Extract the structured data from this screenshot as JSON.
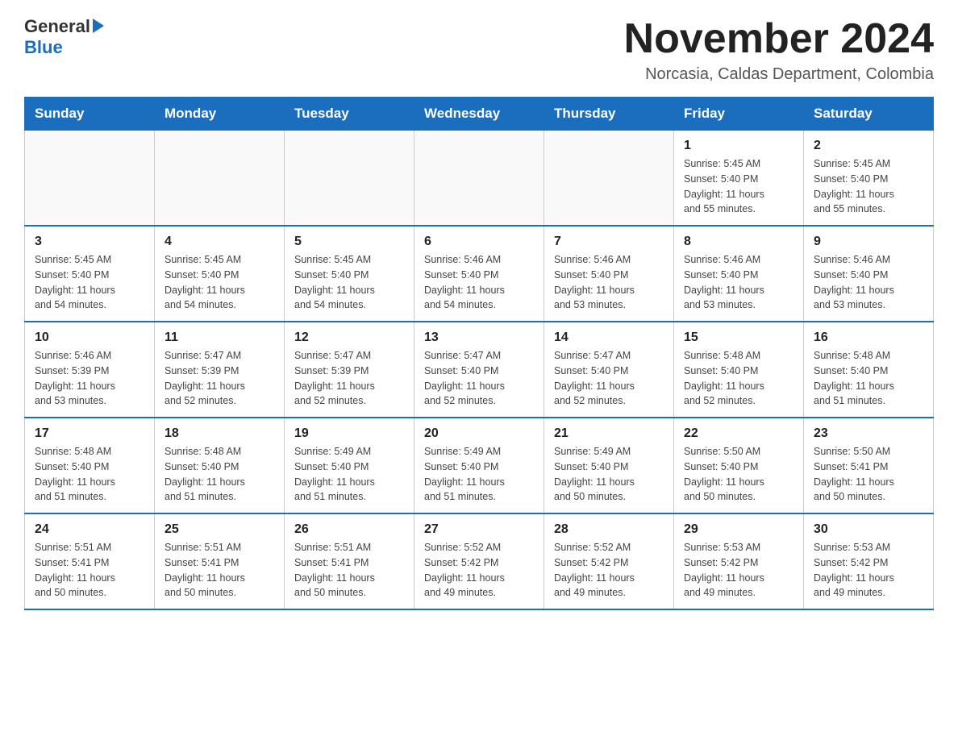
{
  "header": {
    "logo_general": "General",
    "logo_blue": "Blue",
    "month_title": "November 2024",
    "location": "Norcasia, Caldas Department, Colombia"
  },
  "days_of_week": [
    "Sunday",
    "Monday",
    "Tuesday",
    "Wednesday",
    "Thursday",
    "Friday",
    "Saturday"
  ],
  "weeks": [
    {
      "days": [
        {
          "number": "",
          "info": ""
        },
        {
          "number": "",
          "info": ""
        },
        {
          "number": "",
          "info": ""
        },
        {
          "number": "",
          "info": ""
        },
        {
          "number": "",
          "info": ""
        },
        {
          "number": "1",
          "info": "Sunrise: 5:45 AM\nSunset: 5:40 PM\nDaylight: 11 hours\nand 55 minutes."
        },
        {
          "number": "2",
          "info": "Sunrise: 5:45 AM\nSunset: 5:40 PM\nDaylight: 11 hours\nand 55 minutes."
        }
      ]
    },
    {
      "days": [
        {
          "number": "3",
          "info": "Sunrise: 5:45 AM\nSunset: 5:40 PM\nDaylight: 11 hours\nand 54 minutes."
        },
        {
          "number": "4",
          "info": "Sunrise: 5:45 AM\nSunset: 5:40 PM\nDaylight: 11 hours\nand 54 minutes."
        },
        {
          "number": "5",
          "info": "Sunrise: 5:45 AM\nSunset: 5:40 PM\nDaylight: 11 hours\nand 54 minutes."
        },
        {
          "number": "6",
          "info": "Sunrise: 5:46 AM\nSunset: 5:40 PM\nDaylight: 11 hours\nand 54 minutes."
        },
        {
          "number": "7",
          "info": "Sunrise: 5:46 AM\nSunset: 5:40 PM\nDaylight: 11 hours\nand 53 minutes."
        },
        {
          "number": "8",
          "info": "Sunrise: 5:46 AM\nSunset: 5:40 PM\nDaylight: 11 hours\nand 53 minutes."
        },
        {
          "number": "9",
          "info": "Sunrise: 5:46 AM\nSunset: 5:40 PM\nDaylight: 11 hours\nand 53 minutes."
        }
      ]
    },
    {
      "days": [
        {
          "number": "10",
          "info": "Sunrise: 5:46 AM\nSunset: 5:39 PM\nDaylight: 11 hours\nand 53 minutes."
        },
        {
          "number": "11",
          "info": "Sunrise: 5:47 AM\nSunset: 5:39 PM\nDaylight: 11 hours\nand 52 minutes."
        },
        {
          "number": "12",
          "info": "Sunrise: 5:47 AM\nSunset: 5:39 PM\nDaylight: 11 hours\nand 52 minutes."
        },
        {
          "number": "13",
          "info": "Sunrise: 5:47 AM\nSunset: 5:40 PM\nDaylight: 11 hours\nand 52 minutes."
        },
        {
          "number": "14",
          "info": "Sunrise: 5:47 AM\nSunset: 5:40 PM\nDaylight: 11 hours\nand 52 minutes."
        },
        {
          "number": "15",
          "info": "Sunrise: 5:48 AM\nSunset: 5:40 PM\nDaylight: 11 hours\nand 52 minutes."
        },
        {
          "number": "16",
          "info": "Sunrise: 5:48 AM\nSunset: 5:40 PM\nDaylight: 11 hours\nand 51 minutes."
        }
      ]
    },
    {
      "days": [
        {
          "number": "17",
          "info": "Sunrise: 5:48 AM\nSunset: 5:40 PM\nDaylight: 11 hours\nand 51 minutes."
        },
        {
          "number": "18",
          "info": "Sunrise: 5:48 AM\nSunset: 5:40 PM\nDaylight: 11 hours\nand 51 minutes."
        },
        {
          "number": "19",
          "info": "Sunrise: 5:49 AM\nSunset: 5:40 PM\nDaylight: 11 hours\nand 51 minutes."
        },
        {
          "number": "20",
          "info": "Sunrise: 5:49 AM\nSunset: 5:40 PM\nDaylight: 11 hours\nand 51 minutes."
        },
        {
          "number": "21",
          "info": "Sunrise: 5:49 AM\nSunset: 5:40 PM\nDaylight: 11 hours\nand 50 minutes."
        },
        {
          "number": "22",
          "info": "Sunrise: 5:50 AM\nSunset: 5:40 PM\nDaylight: 11 hours\nand 50 minutes."
        },
        {
          "number": "23",
          "info": "Sunrise: 5:50 AM\nSunset: 5:41 PM\nDaylight: 11 hours\nand 50 minutes."
        }
      ]
    },
    {
      "days": [
        {
          "number": "24",
          "info": "Sunrise: 5:51 AM\nSunset: 5:41 PM\nDaylight: 11 hours\nand 50 minutes."
        },
        {
          "number": "25",
          "info": "Sunrise: 5:51 AM\nSunset: 5:41 PM\nDaylight: 11 hours\nand 50 minutes."
        },
        {
          "number": "26",
          "info": "Sunrise: 5:51 AM\nSunset: 5:41 PM\nDaylight: 11 hours\nand 50 minutes."
        },
        {
          "number": "27",
          "info": "Sunrise: 5:52 AM\nSunset: 5:42 PM\nDaylight: 11 hours\nand 49 minutes."
        },
        {
          "number": "28",
          "info": "Sunrise: 5:52 AM\nSunset: 5:42 PM\nDaylight: 11 hours\nand 49 minutes."
        },
        {
          "number": "29",
          "info": "Sunrise: 5:53 AM\nSunset: 5:42 PM\nDaylight: 11 hours\nand 49 minutes."
        },
        {
          "number": "30",
          "info": "Sunrise: 5:53 AM\nSunset: 5:42 PM\nDaylight: 11 hours\nand 49 minutes."
        }
      ]
    }
  ]
}
